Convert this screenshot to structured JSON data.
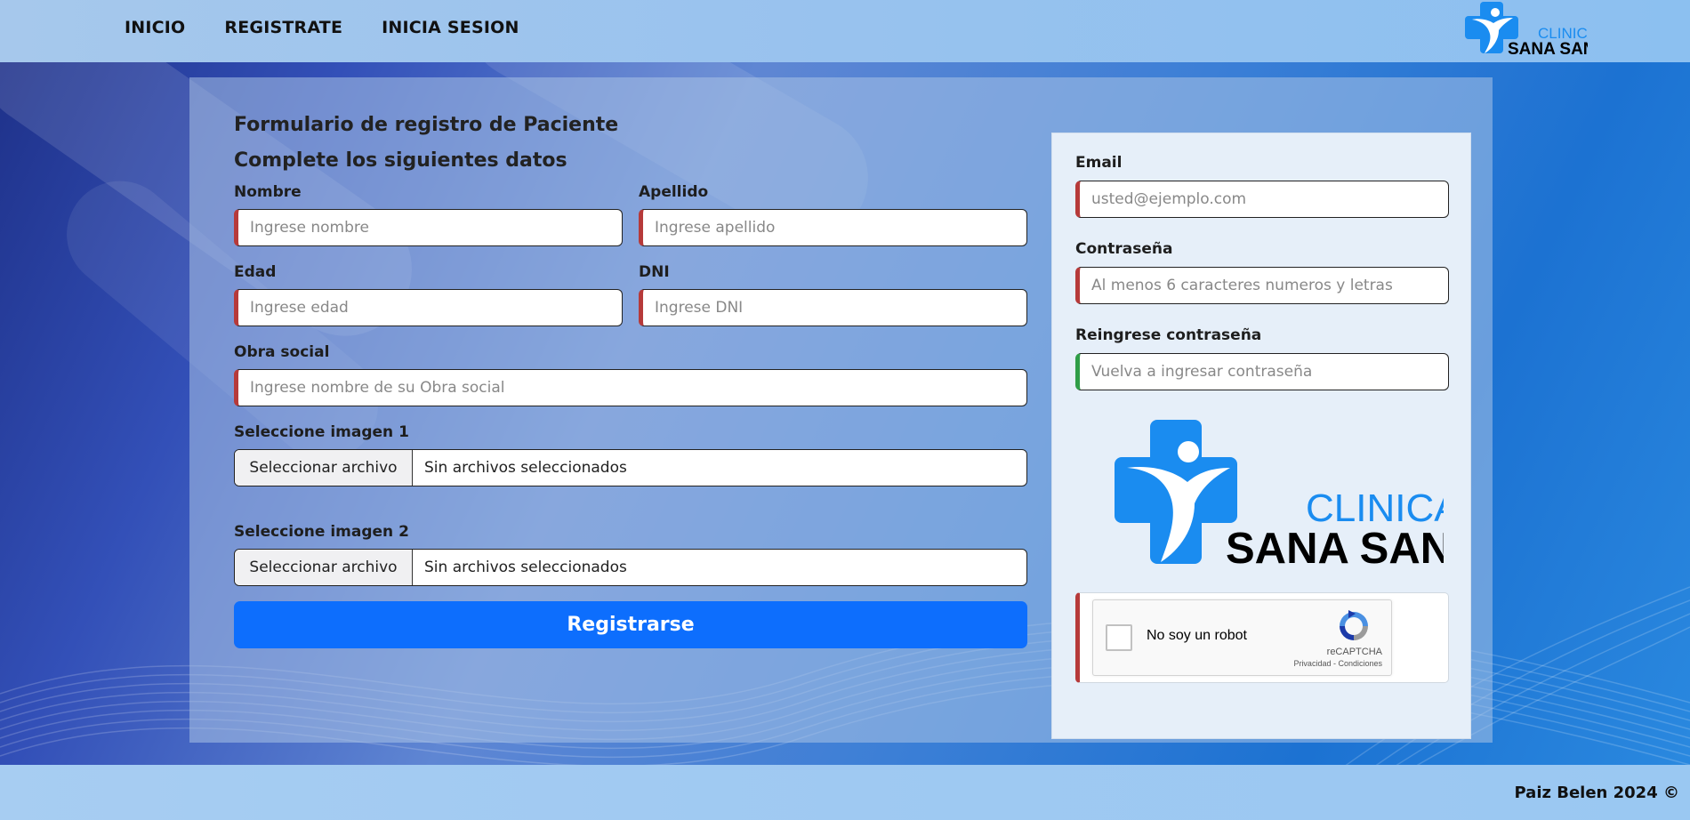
{
  "nav": {
    "items": [
      "INICIO",
      "REGISTRATE",
      "INICIA SESION"
    ]
  },
  "logo": {
    "line1": "CLINICA",
    "line2": "SANA SANA",
    "icon": "medical-cross-person-icon",
    "colors": {
      "primary": "#1a8cf0",
      "text": "#000000"
    }
  },
  "form": {
    "title": "Formulario de registro de Paciente",
    "subtitle": "Complete los siguientes datos",
    "fields": {
      "nombre": {
        "label": "Nombre",
        "placeholder": "Ingrese nombre"
      },
      "apellido": {
        "label": "Apellido",
        "placeholder": "Ingrese apellido"
      },
      "edad": {
        "label": "Edad",
        "placeholder": "Ingrese edad"
      },
      "dni": {
        "label": "DNI",
        "placeholder": "Ingrese DNI"
      },
      "obra_social": {
        "label": "Obra social",
        "placeholder": "Ingrese nombre de su Obra social"
      },
      "imagen1": {
        "label": "Seleccione imagen 1",
        "button": "Seleccionar archivo",
        "status": "Sin archivos seleccionados"
      },
      "imagen2": {
        "label": "Seleccione imagen 2",
        "button": "Seleccionar archivo",
        "status": "Sin archivos seleccionados"
      },
      "email": {
        "label": "Email",
        "placeholder": "usted@ejemplo.com"
      },
      "password": {
        "label": "Contraseña",
        "placeholder": "Al menos 6 caracteres numeros y letras"
      },
      "password2": {
        "label": "Reingrese contraseña",
        "placeholder": "Vuelva a ingresar contraseña"
      }
    },
    "submit_label": "Registrarse"
  },
  "captcha": {
    "label": "No soy un robot",
    "brand": "reCAPTCHA",
    "links": "Privacidad - Condiciones"
  },
  "footer": {
    "text": "Paiz Belen 2024 ©"
  },
  "colors": {
    "accent": "#0d6efd",
    "invalid": "#b63a3a",
    "valid": "#2f9d47"
  }
}
